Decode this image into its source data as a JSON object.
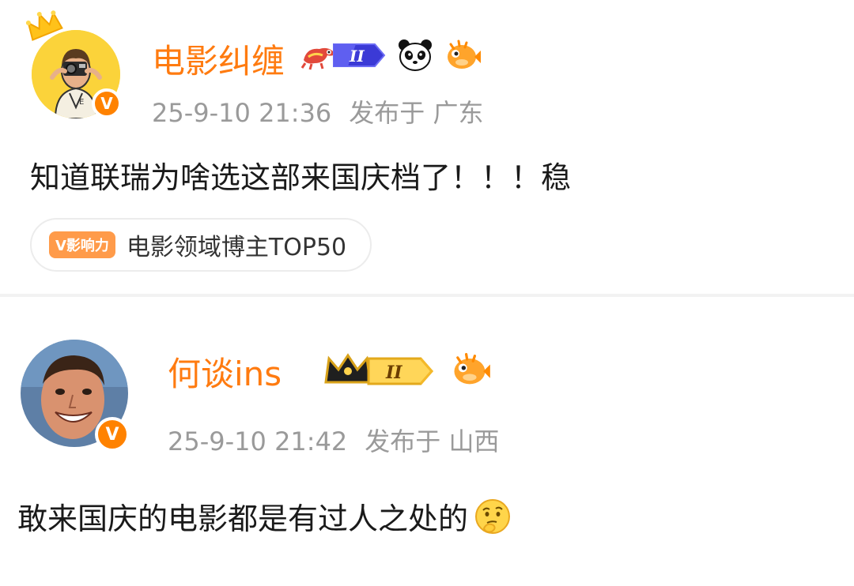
{
  "posts": [
    {
      "username": "电影纠缠",
      "level": "II",
      "date": "25-9-10 21:36",
      "location": "发布于 广东",
      "content": "知道联瑞为啥选这部来国庆档了！！！稳",
      "influence_tag": "V影响力",
      "influence_text": "电影领域博主TOP50",
      "verified": "V"
    },
    {
      "username": "何谈ins",
      "level": "II",
      "date": "25-9-10 21:42",
      "location": "发布于 山西",
      "content": "敢来国庆的电影都是有过人之处的",
      "verified": "V"
    }
  ],
  "colors": {
    "username": "#ff7b10",
    "verified_badge": "#ff8200",
    "meta": "#9a9a9a",
    "content": "#1a1a1a"
  },
  "icons": [
    "crown-icon",
    "dragon-badge-icon",
    "level-badge-icon",
    "panda-icon",
    "pufferfish-icon",
    "crown-level-badge-icon",
    "thinking-emoji-icon"
  ]
}
